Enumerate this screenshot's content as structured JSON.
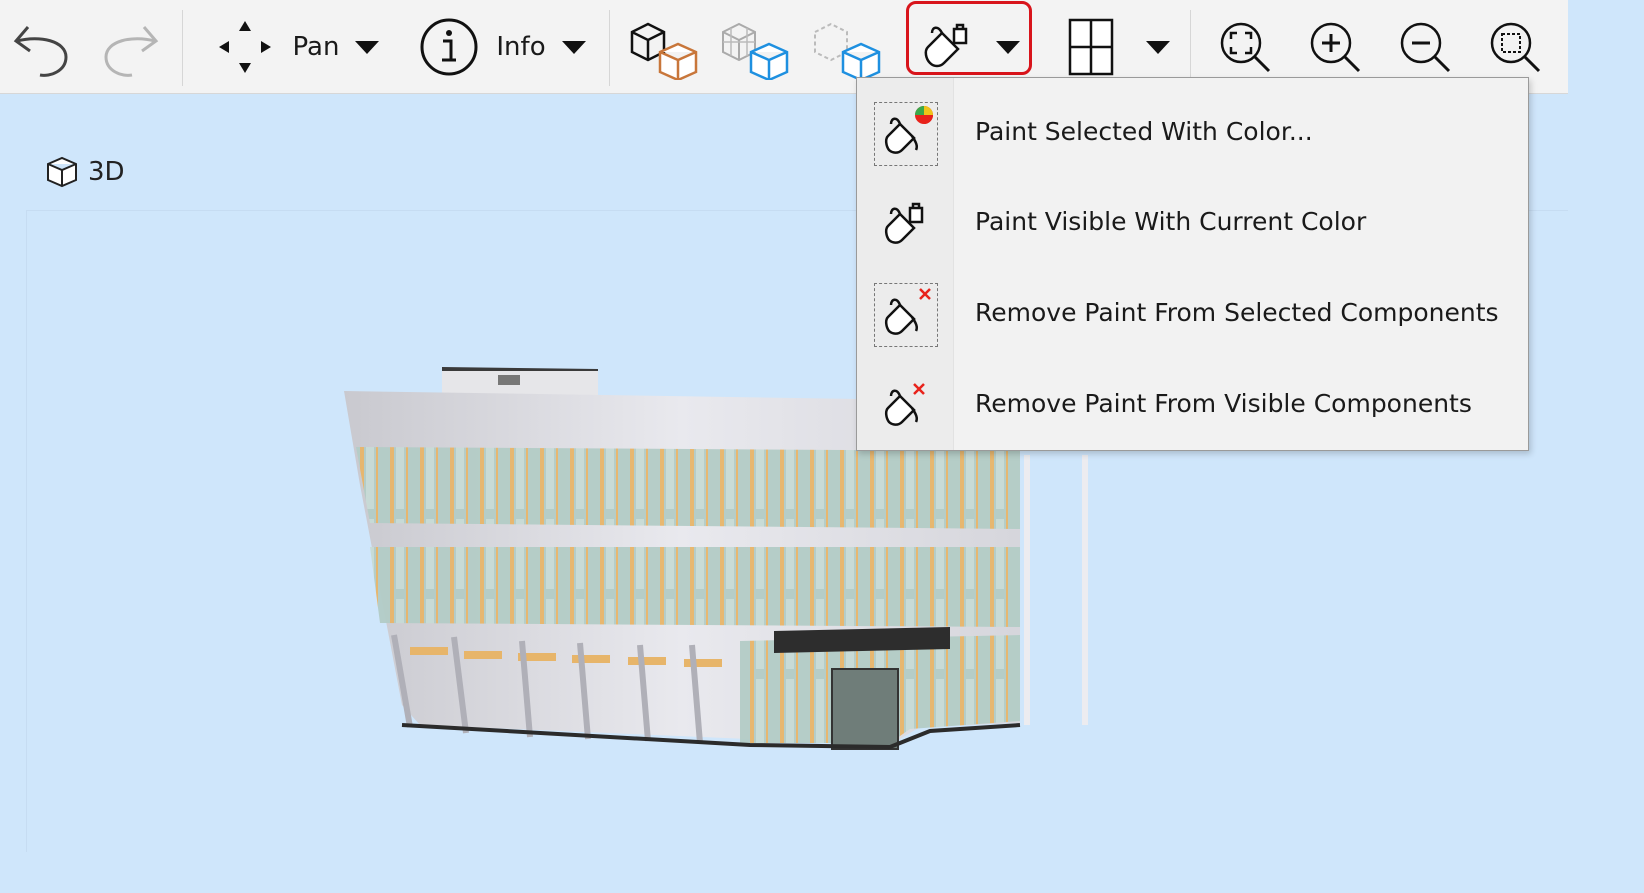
{
  "toolbar": {
    "pan_label": "Pan",
    "info_label": "Info"
  },
  "view": {
    "label": "3D"
  },
  "paint_menu": {
    "items": [
      {
        "label": "Paint Selected With Color..."
      },
      {
        "label": "Paint Visible With Current Color"
      },
      {
        "label": "Remove Paint From Selected Components"
      },
      {
        "label": "Remove Paint From Visible Components"
      }
    ]
  },
  "colors": {
    "toolbar_bg": "#f3f3f3",
    "viewport_bg": "#cfe6fb",
    "highlight": "#d8141b",
    "accent_blue": "#1e90e0",
    "accent_orange": "#c8763a"
  },
  "icons": [
    "undo-icon",
    "redo-icon",
    "pan-icon",
    "info-icon",
    "show-all-icon",
    "isolate-icon",
    "hide-icon",
    "paint-bucket-icon",
    "section-box-icon",
    "zoom-fit-icon",
    "zoom-in-icon",
    "zoom-out-icon",
    "zoom-window-icon"
  ]
}
